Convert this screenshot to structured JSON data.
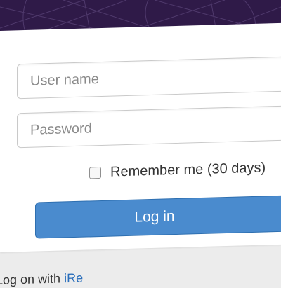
{
  "header": {
    "background": "#2f1a48"
  },
  "login_form": {
    "username_placeholder": "User name",
    "password_placeholder": "Password",
    "remember_label": "Remember me (30 days)",
    "remember_checked": false,
    "login_button_label": "Log in",
    "button_color": "#4a8bce"
  },
  "footer": {
    "prefix": "Log on with ",
    "link_label": "iRe"
  }
}
